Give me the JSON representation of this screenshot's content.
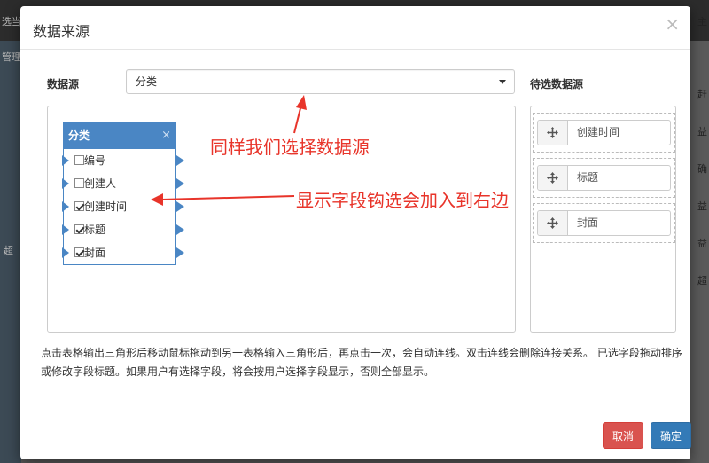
{
  "modal": {
    "title": "数据来源",
    "close": "×",
    "source_label": "数据源",
    "source_value": "分类",
    "pending_label": "待选数据源"
  },
  "table": {
    "name": "分类",
    "close": "×",
    "fields": [
      {
        "label": "编号",
        "checked": false
      },
      {
        "label": "创建人",
        "checked": false
      },
      {
        "label": "创建时间",
        "checked": true
      },
      {
        "label": "标题",
        "checked": true
      },
      {
        "label": "封面",
        "checked": true
      }
    ]
  },
  "pending": [
    {
      "label": "创建时间",
      "icon": "move-icon"
    },
    {
      "label": "标题",
      "icon": "move-icon"
    },
    {
      "label": "封面",
      "icon": "move-icon"
    }
  ],
  "note": "点击表格输出三角形后移动鼠标拖动到另一表格输入三角形后，再点击一次，会自动连线。双击连线会删除连接关系。 已选字段拖动排序或修改字段标题。如果用户有选择字段，将会按用户选择字段显示，否则全部显示。",
  "buttons": {
    "cancel": "取消",
    "ok": "确定"
  },
  "annotations": {
    "top": "同样我们选择数据源",
    "middle": "显示字段钩选会加入到右边"
  },
  "colors": {
    "accent": "#4a86c4",
    "annotation": "#e8342a",
    "cancel": "#d9534f",
    "ok": "#337ab7"
  },
  "background": {
    "fragments": [
      "选当前",
      "管理",
      "赶",
      "益",
      "确",
      "益",
      "益",
      "超",
      "超",
      "主"
    ]
  }
}
